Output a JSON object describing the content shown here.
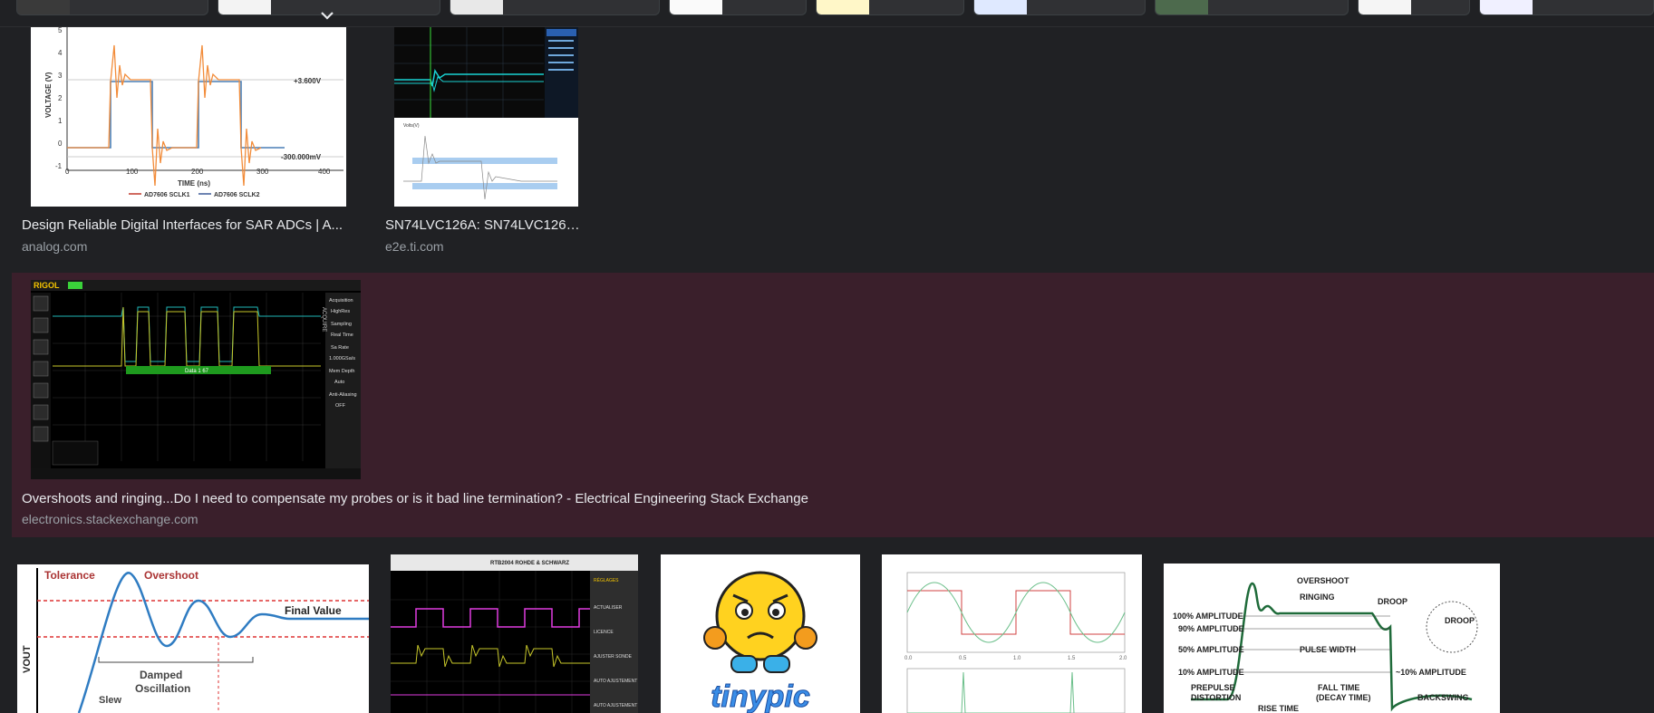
{
  "colors": {
    "background": "#202124",
    "selected_row": "#3a1f2b",
    "title_text": "#e8eaed",
    "domain_text": "#9aa0a6"
  },
  "chip_strip": {
    "icon": "chevron-down-icon"
  },
  "row1": [
    {
      "title": "Design Reliable Digital Interfaces for SAR ADCs | A...",
      "domain": "analog.com",
      "chart": {
        "ylabel": "VOLTAGE (V)",
        "xlabel": "TIME (ns)",
        "label_high": "+3.600V",
        "label_low": "-300.000mV",
        "legend1": "AD7606 SCLK1",
        "legend2": "AD7606 SCLK2",
        "yticks": [
          "5",
          "4",
          "3",
          "2",
          "1",
          "0",
          "-1"
        ],
        "xticks": [
          "0",
          "100",
          "200",
          "300",
          "400"
        ]
      }
    },
    {
      "title": "SN74LVC126A: SN74LVC126A...",
      "domain": "e2e.ti.com",
      "sub_ylabel": "Volts(V)"
    }
  ],
  "selected": {
    "title": "Overshoots and ringing...Do I need to compensate my probes or is it bad line termination? - Electrical Engineering Stack Exchange",
    "domain": "electronics.stackexchange.com",
    "scope": {
      "brand": "RIGOL",
      "bus_label": "Data 1 67",
      "side_menu": [
        "Acquisition",
        "HighRes",
        "Sampling",
        "Real Time",
        "Sa Rate",
        "1.000GSa/s",
        "Mem Depth",
        "Auto",
        "Anti-Aliasing",
        "OFF"
      ],
      "side_title": "ACQUIRE"
    }
  },
  "row3": {
    "overshoot_diagram": {
      "tolerance": "Tolerance",
      "overshoot": "Overshoot",
      "final_value": "Final Value",
      "damped": "Damped",
      "oscillation": "Oscillation",
      "vout": "VOUT",
      "slew": "Slew"
    },
    "rs_scope": {
      "header": "RTB2004 ROHDE & SCHWARZ",
      "menu": [
        "RÉGLAGES",
        "ACTUALISER",
        "LICENCE",
        "AJUSTER SONDE",
        "AUTO AJUSTEMENT",
        "AUTO AJUSTEMENT"
      ]
    },
    "tinypic": {
      "logo": "tinypic"
    },
    "square_wave_plot": {
      "xticks": [
        "0.0",
        "0.5",
        "1.0",
        "1.5",
        "2.0"
      ]
    },
    "pulse_diagram": {
      "labels": [
        "OVERSHOOT",
        "RINGING",
        "DROOP",
        "DROOP",
        "100% AMPLITUDE",
        "90% AMPLITUDE",
        "50% AMPLITUDE",
        "PULSE WIDTH",
        "10% AMPLITUDE",
        "~10% AMPLITUDE",
        "PREPULSE",
        "DISTORTION",
        "FALL TIME",
        "(DECAY TIME)",
        "BACKSWING",
        "RISE TIME"
      ]
    }
  }
}
